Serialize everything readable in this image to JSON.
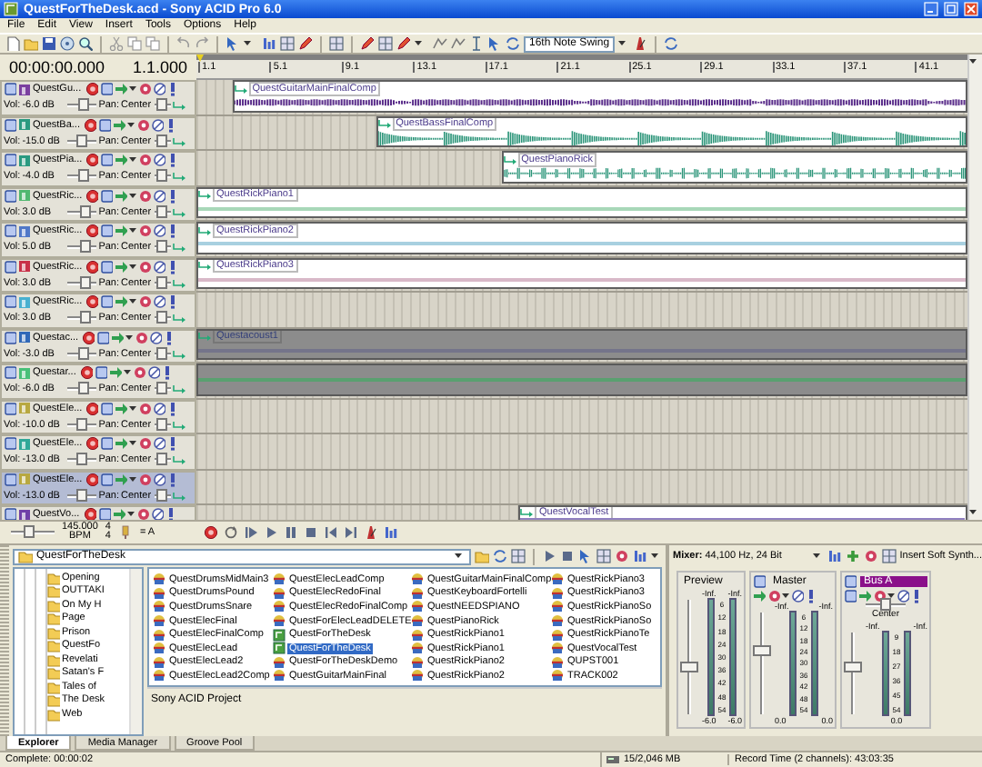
{
  "window": {
    "title": "QuestForTheDesk.acd - Sony ACID Pro 6.0"
  },
  "menu": [
    "File",
    "Edit",
    "View",
    "Insert",
    "Tools",
    "Options",
    "Help"
  ],
  "toolbar": {
    "swing": "16th Note Swing"
  },
  "time": {
    "position": "00:00:00.000",
    "measure": "1.1.000"
  },
  "ruler": [
    "1.1",
    "5.1",
    "9.1",
    "13.1",
    "17.1",
    "21.1",
    "25.1",
    "29.1",
    "33.1",
    "37.1",
    "41.1"
  ],
  "tracks": [
    {
      "name": "QuestGu...",
      "color": "#7b3fa0",
      "vol_label": "Vol:",
      "volume": {
        "label": "-6.0 dB",
        "level": 0.55
      },
      "pan_label": "Pan:",
      "pan": {
        "label": "Center",
        "level": 0.5
      },
      "selected": false,
      "event": {
        "kind": "waveform",
        "label": "QuestGuitarMainFinalComp",
        "color": "#5a2d8a"
      }
    },
    {
      "name": "QuestBa...",
      "color": "#2a9a80",
      "vol_label": "Vol:",
      "volume": {
        "label": "-15.0 dB",
        "level": 0.45
      },
      "pan_label": "Pan:",
      "pan": {
        "label": "Center",
        "level": 0.5
      },
      "selected": false,
      "event": {
        "kind": "waveform",
        "label": "QuestBassFinalComp",
        "color": "#2a9478"
      }
    },
    {
      "name": "QuestPia...",
      "color": "#2a9a80",
      "vol_label": "Vol:",
      "volume": {
        "label": "-4.0 dB",
        "level": 0.6
      },
      "pan_label": "Pan:",
      "pan": {
        "label": "Center",
        "level": 0.5
      },
      "selected": false,
      "event": {
        "kind": "waveform",
        "label": "QuestPianoRick",
        "color": "#2a9478"
      }
    },
    {
      "name": "QuestRic...",
      "color": "#50b870",
      "vol_label": "Vol:",
      "volume": {
        "label": "3.0 dB",
        "level": 0.7
      },
      "pan_label": "Pan:",
      "pan": {
        "label": "Center",
        "level": 0.5
      },
      "selected": false,
      "event": {
        "kind": "blank",
        "label": "QuestRickPiano1",
        "color": "#a8d8b8"
      }
    },
    {
      "name": "QuestRic...",
      "color": "#5078c8",
      "vol_label": "Vol:",
      "volume": {
        "label": "5.0 dB",
        "level": 0.72
      },
      "pan_label": "Pan:",
      "pan": {
        "label": "Center",
        "level": 0.5
      },
      "selected": false,
      "event": {
        "kind": "blank",
        "label": "QuestRickPiano2",
        "color": "#a8d0e0"
      }
    },
    {
      "name": "QuestRic...",
      "color": "#c83048",
      "vol_label": "Vol:",
      "volume": {
        "label": "3.0 dB",
        "level": 0.7
      },
      "pan_label": "Pan:",
      "pan": {
        "label": "Center",
        "level": 0.5
      },
      "selected": false,
      "event": {
        "kind": "blank",
        "label": "QuestRickPiano3",
        "color": "#d8b8c8"
      }
    },
    {
      "name": "QuestRic...",
      "color": "#48b0d0",
      "vol_label": "Vol:",
      "volume": {
        "label": "3.0 dB",
        "level": 0.7
      },
      "pan_label": "Pan:",
      "pan": {
        "label": "Center",
        "level": 0.5
      },
      "selected": false
    },
    {
      "name": "Questac...",
      "color": "#3068b8",
      "vol_label": "Vol:",
      "volume": {
        "label": "-3.0 dB",
        "level": 0.6
      },
      "pan_label": "Pan:",
      "pan": {
        "label": "Center",
        "level": 0.5
      },
      "selected": false,
      "event": {
        "kind": "muted",
        "label": "Questacoust1",
        "color": "#74748a"
      }
    },
    {
      "name": "Questar...",
      "color": "#48c078",
      "vol_label": "Vol:",
      "volume": {
        "label": "-6.0 dB",
        "level": 0.55
      },
      "pan_label": "Pan:",
      "pan": {
        "label": "Center",
        "level": 0.5
      },
      "selected": false,
      "event": {
        "kind": "muted",
        "color": "#5aa070"
      }
    },
    {
      "name": "QuestEle...",
      "color": "#b8a840",
      "vol_label": "Vol:",
      "volume": {
        "label": "-10.0 dB",
        "level": 0.5
      },
      "pan_label": "Pan:",
      "pan": {
        "label": "Center",
        "level": 0.5
      },
      "selected": false
    },
    {
      "name": "QuestEle...",
      "color": "#30a898",
      "vol_label": "Vol:",
      "volume": {
        "label": "-13.0 dB",
        "level": 0.45
      },
      "pan_label": "Pan:",
      "pan": {
        "label": "Center",
        "level": 0.5
      },
      "selected": false
    },
    {
      "name": "QuestEle...",
      "color": "#b8a840",
      "vol_label": "Vol:",
      "volume": {
        "label": "-13.0 dB",
        "level": 0.45
      },
      "pan_label": "Pan:",
      "pan": {
        "label": "Center",
        "level": 0.5
      },
      "selected": true
    },
    {
      "name": "QuestVo...",
      "color": "#7040a8",
      "selected": false,
      "event": {
        "kind": "blank",
        "label": "QuestVocalTest",
        "color": "#9080c0"
      }
    }
  ],
  "transport": {
    "level": 0.4,
    "tempo": "145.000",
    "tempo_unit": "BPM",
    "beats": "4",
    "beat_unit": "4",
    "key": "= A"
  },
  "explorer": {
    "path": "QuestForTheDesk",
    "folders": [
      "Opening",
      "OUTTAKI",
      "On My H",
      "Page",
      "Prison",
      "QuestFo",
      "Revelati",
      "Satan's F",
      "Tales of",
      "The Desk",
      "Web"
    ],
    "files": [
      {
        "name": "QuestDrumsMidMain3",
        "kind": "audio",
        "selected": false
      },
      {
        "name": "QuestDrumsPound",
        "kind": "audio",
        "selected": false
      },
      {
        "name": "QuestDrumsSnare",
        "kind": "audio",
        "selected": false
      },
      {
        "name": "QuestElecFinal",
        "kind": "audio",
        "selected": false
      },
      {
        "name": "QuestElecFinalComp",
        "kind": "audio",
        "selected": false
      },
      {
        "name": "QuestElecLead",
        "kind": "audio",
        "selected": false
      },
      {
        "name": "QuestElecLead2",
        "kind": "audio",
        "selected": false
      },
      {
        "name": "QuestElecLead2Comp",
        "kind": "audio",
        "selected": false
      },
      {
        "name": "QuestElecLeadComp",
        "kind": "audio",
        "selected": false
      },
      {
        "name": "QuestElecRedoFinal",
        "kind": "audio",
        "selected": false
      },
      {
        "name": "QuestElecRedoFinalComp",
        "kind": "audio",
        "selected": false
      },
      {
        "name": "QuestForElecLeadDELETE",
        "kind": "audio",
        "selected": false
      },
      {
        "name": "QuestForTheDesk",
        "kind": "project",
        "selected": false
      },
      {
        "name": "QuestForTheDesk",
        "kind": "project",
        "selected": true
      },
      {
        "name": "QuestForTheDeskDemo",
        "kind": "audio",
        "selected": false
      },
      {
        "name": "QuestGuitarMainFinal",
        "kind": "audio",
        "selected": false
      },
      {
        "name": "QuestGuitarMainFinalComp",
        "kind": "audio",
        "selected": false
      },
      {
        "name": "QuestKeyboardFortelli",
        "kind": "audio",
        "selected": false
      },
      {
        "name": "QuestNEEDSPIANO",
        "kind": "audio",
        "selected": false
      },
      {
        "name": "QuestPianoRick",
        "kind": "audio",
        "selected": false
      },
      {
        "name": "QuestRickPiano1",
        "kind": "audio",
        "selected": false
      },
      {
        "name": "QuestRickPiano1",
        "kind": "audio",
        "selected": false
      },
      {
        "name": "QuestRickPiano2",
        "kind": "audio",
        "selected": false
      },
      {
        "name": "QuestRickPiano2",
        "kind": "audio",
        "selected": false
      },
      {
        "name": "QuestRickPiano3",
        "kind": "audio",
        "selected": false
      },
      {
        "name": "QuestRickPiano3",
        "kind": "audio",
        "selected": false
      },
      {
        "name": "QuestRickPianoSo",
        "kind": "audio",
        "selected": false
      },
      {
        "name": "QuestRickPianoSo",
        "kind": "audio",
        "selected": false
      },
      {
        "name": "QuestRickPianoTe",
        "kind": "audio",
        "selected": false
      },
      {
        "name": "QuestVocalTest",
        "kind": "audio",
        "selected": false
      },
      {
        "name": "QUPST001",
        "kind": "audio",
        "selected": false
      },
      {
        "name": "TRACK002",
        "kind": "audio",
        "selected": false
      }
    ],
    "description": "Sony ACID Project"
  },
  "mixer": {
    "format": "**Mixer:** 44,100 Hz, 24 Bit",
    "insert": "Insert Soft Synth...",
    "strips": [
      {
        "name": "Preview",
        "kind": "preview",
        "selected": false,
        "peaks": [
          "-Inf.",
          "-Inf."
        ],
        "scale": [
          "6",
          "12",
          "18",
          "24",
          "30",
          "36",
          "42",
          "48",
          "54"
        ],
        "readouts": [
          "-6.0",
          "-6.0"
        ],
        "level": 0.4
      },
      {
        "name": "Master",
        "kind": "master",
        "selected": false,
        "peaks": [
          "-Inf.",
          "-Inf."
        ],
        "scale": [
          "6",
          "12",
          "18",
          "24",
          "30",
          "36",
          "42",
          "48",
          "54"
        ],
        "readouts": [
          "0.0",
          "0.0"
        ],
        "level": 0.65
      },
      {
        "name": "Bus A",
        "kind": "bus",
        "selected": true,
        "pan": {
          "label": "Center",
          "level": 0.5
        },
        "peaks": [
          "-Inf.",
          "-Inf."
        ],
        "scale": [
          "9",
          "18",
          "27",
          "36",
          "45",
          "54"
        ],
        "readouts": [
          "0.0"
        ],
        "level": 0.6
      }
    ]
  },
  "tabs": [
    {
      "label": "Explorer",
      "selected": true
    },
    {
      "label": "Media Manager",
      "selected": false
    },
    {
      "label": "Groove Pool",
      "selected": false
    }
  ],
  "status_bar": {
    "message": "Complete: 00:00:02",
    "memory": "15/2,046 MB",
    "record_time": "Record Time (2 channels): 43:03:35"
  }
}
